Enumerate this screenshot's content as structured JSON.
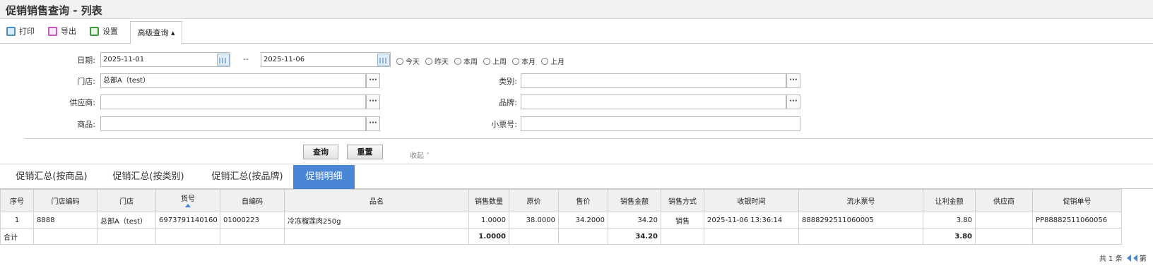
{
  "page": {
    "title": "促销销售查询 - 列表"
  },
  "toolbar": {
    "print": "打印",
    "export": "导出",
    "settings": "设置",
    "advanced": "高级查询 ▴"
  },
  "form": {
    "date_label": "日期:",
    "date_from": "2025-11-01",
    "date_sep": "--",
    "date_to": "2025-11-06",
    "quick": [
      "今天",
      "昨天",
      "本周",
      "上周",
      "本月",
      "上月"
    ],
    "store_label": "门店:",
    "store_value": "总部A（test）",
    "category_label": "类别:",
    "supplier_label": "供应商:",
    "brand_label": "品牌:",
    "product_label": "商品:",
    "receipt_label": "小票号:",
    "picker": "···",
    "query_btn": "查询",
    "reset_btn": "重置",
    "collapse": "收起 ˄"
  },
  "tabs": [
    "促销汇总(按商品)",
    "促销汇总(按类别)",
    "促销汇总(按品牌)",
    "促销明细"
  ],
  "table": {
    "headers": [
      "序号",
      "门店编码",
      "门店",
      "货号",
      "自编码",
      "品名",
      "销售数量",
      "原价",
      "售价",
      "销售金额",
      "销售方式",
      "收银时间",
      "流水票号",
      "让利金额",
      "供应商",
      "促销单号"
    ],
    "row": {
      "no": "1",
      "store_code": "8888",
      "store": "总部A（test）",
      "sku": "6973791140160",
      "self_code": "01000223",
      "name": "冷冻榴莲肉250g",
      "qty": "1.0000",
      "orig_price": "38.0000",
      "price": "34.2000",
      "amount": "34.20",
      "method": "销售",
      "time": "2025-11-06 13:36:14",
      "serial": "8888292511060005",
      "discount": "3.80",
      "supplier": "",
      "promo_no": "PP88882511060056"
    },
    "total": {
      "label": "合计",
      "qty": "1.0000",
      "amount": "34.20",
      "discount": "3.80"
    }
  },
  "pager": {
    "summary": "共 1 条",
    "page_prefix": "第"
  }
}
